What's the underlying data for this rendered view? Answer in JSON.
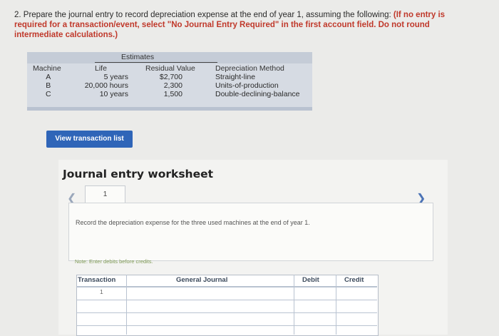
{
  "question": {
    "lead": "2. Prepare the journal entry to record depreciation expense at the end of year 1, assuming the following: ",
    "note": "(If no entry is required for a transaction/event, select \"No Journal Entry Required\" in the first account field. Do not round intermediate calculations.)"
  },
  "estimates_table": {
    "group_label": "Estimates",
    "headers": {
      "machine": "Machine",
      "life": "Life",
      "residual": "Residual Value",
      "method": "Depreciation Method"
    },
    "rows": [
      {
        "machine": "A",
        "life": "5 years",
        "residual": "$2,700",
        "method": "Straight-line"
      },
      {
        "machine": "B",
        "life": "20,000 hours",
        "residual": "2,300",
        "method": "Units-of-production"
      },
      {
        "machine": "C",
        "life": "10 years",
        "residual": "1,500",
        "method": "Double-declining-balance"
      }
    ]
  },
  "view_button_label": "View transaction list",
  "worksheet": {
    "title": "Journal entry worksheet",
    "page_number": "1",
    "instruction": "Record the depreciation expense for the three used machines at the end of year 1.",
    "note": "Note: Enter debits before credits.",
    "columns": {
      "transaction": "Transaction",
      "general_journal": "General Journal",
      "debit": "Debit",
      "credit": "Credit"
    },
    "first_row_number": "1"
  }
}
